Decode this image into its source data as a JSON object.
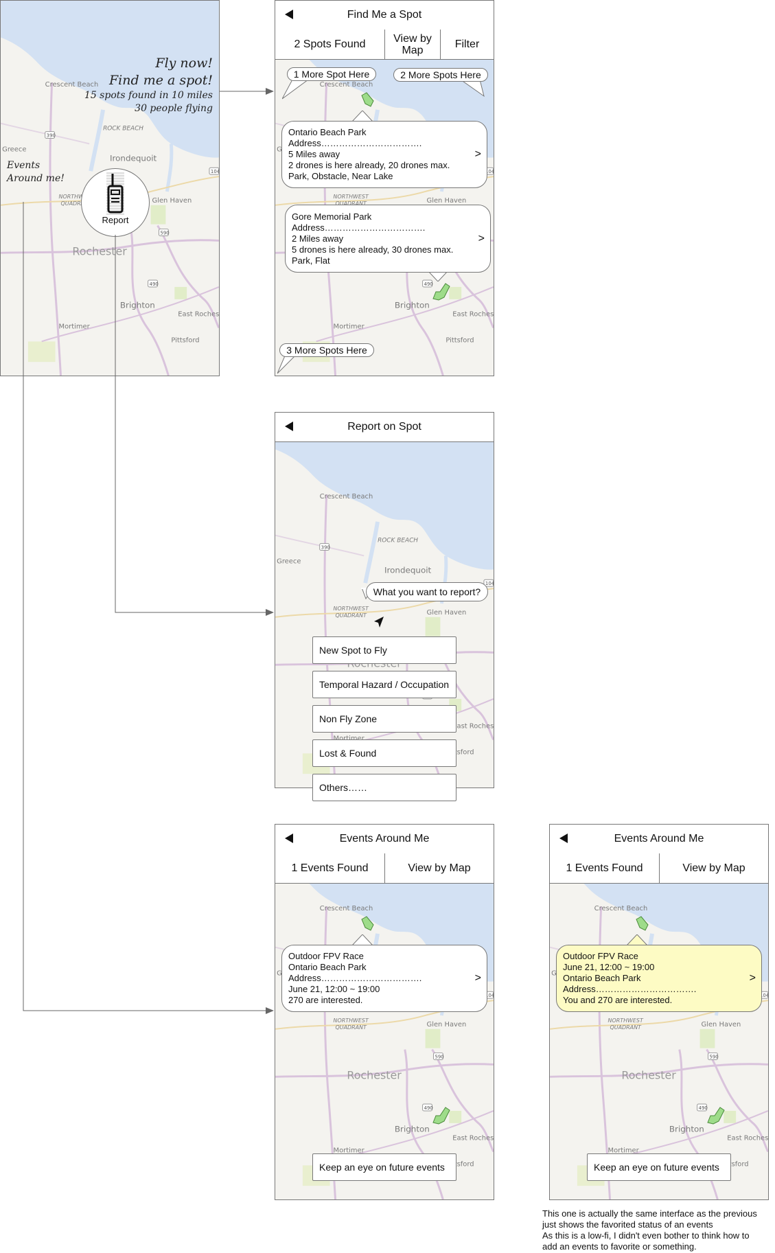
{
  "home": {
    "headline1": "Fly now!",
    "headline2": "Find me a spot!",
    "stat1": "15 spots found in 10 miles",
    "stat2": "30 people flying",
    "events_line1": "Events",
    "events_line2": "Around me!",
    "report_label": "Report",
    "radio_icon": "walkie-talkie-icon"
  },
  "find_spot": {
    "title": "Find Me a Spot",
    "tabs": [
      "2 Spots Found",
      "View by Map",
      "Filter"
    ],
    "callouts": [
      "1 More Spot Here",
      "2 More Spots Here",
      "3 More Spots Here"
    ],
    "cards": [
      {
        "lines": [
          "Ontario Beach Park",
          "Address…………………………….",
          "5 Miles away",
          "2 drones is here already, 20 drones max.",
          "Park, Obstacle, Near Lake"
        ],
        "chevron": ">"
      },
      {
        "lines": [
          "Gore Memorial Park",
          "Address…………………………….",
          "2 Miles away",
          "5 drones is here already, 30 drones max.",
          "Park, Flat"
        ],
        "chevron": ">"
      }
    ]
  },
  "report": {
    "title": "Report on Spot",
    "prompt": "What you want to report?",
    "options": [
      "New Spot to Fly",
      "Temporal Hazard / Occupation",
      "Non Fly Zone",
      "Lost & Found",
      "Others……"
    ]
  },
  "events": {
    "title": "Events Around Me",
    "tabs": [
      "1 Events Found",
      "View by Map"
    ],
    "card_lines": [
      "Outdoor FPV Race",
      "Ontario Beach Park",
      "Address…………………………….",
      "June 21, 12:00 ~ 19:00",
      "270 are interested."
    ],
    "chevron": ">",
    "button": "Keep an eye on future events"
  },
  "events_fav": {
    "title": "Events Around Me",
    "tabs": [
      "1 Events Found",
      "View by Map"
    ],
    "card_lines": [
      "Outdoor FPV Race",
      "June 21, 12:00 ~ 19:00",
      "Ontario Beach Park",
      "Address…………………………….",
      "You and 270 are interested."
    ],
    "chevron": ">",
    "button": "Keep an eye on future events",
    "card_color": "#fdfbc4"
  },
  "map_labels": [
    "Crescent Beach",
    "ROCK BEACH",
    "Greece",
    "Irondequoit",
    "NORTHWEST QUADRANT",
    "Glen Haven",
    "Rochester",
    "Brighton",
    "East Rochester",
    "Mortimer",
    "Pittsford",
    "390",
    "590",
    "490",
    "104"
  ],
  "note": [
    "This one is actually the same interface as the previous",
    "just shows the favorited status of an events",
    "As this is a low-fi, I didn't even bother to think how to",
    "add an events to favorite or something."
  ],
  "colors": {
    "water": "#d3e1f3",
    "land": "#f4f3ef",
    "road": "#d9c3dc",
    "park": "#e1edc8",
    "spot": "#9edc8a",
    "favorite": "#fdfbc4"
  }
}
